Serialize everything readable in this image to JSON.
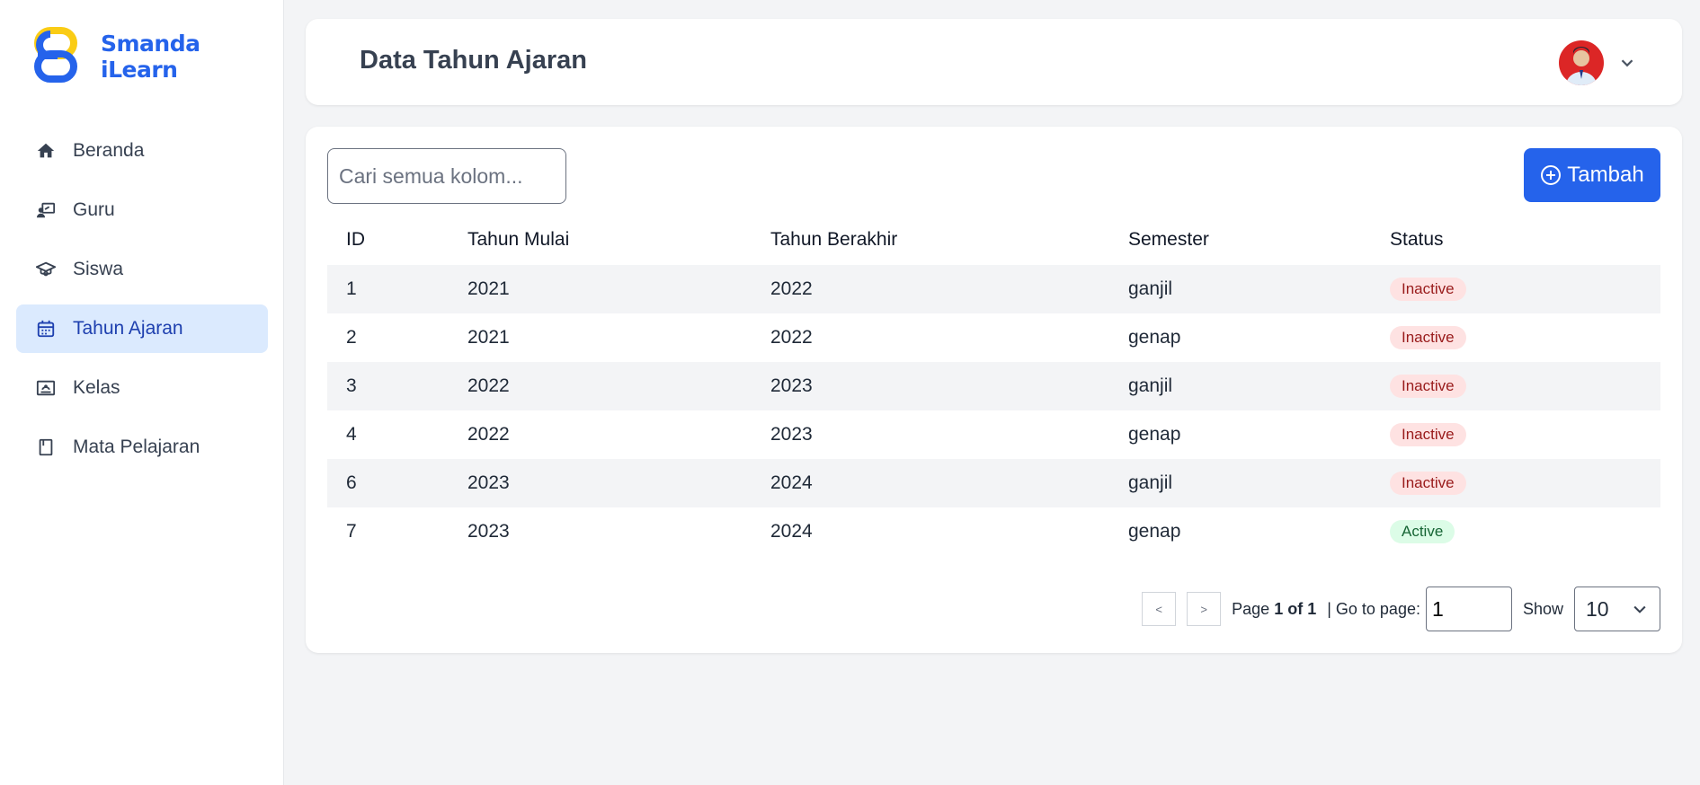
{
  "app": {
    "logo_line1": "Smanda",
    "logo_line2": "iLearn",
    "brand_colors": {
      "blue": "#2563eb",
      "yellow": "#facc15"
    }
  },
  "sidebar": {
    "items": [
      {
        "label": "Beranda",
        "icon": "home-icon",
        "active": false
      },
      {
        "label": "Guru",
        "icon": "teacher-icon",
        "active": false
      },
      {
        "label": "Siswa",
        "icon": "graduation-cap-icon",
        "active": false
      },
      {
        "label": "Tahun Ajaran",
        "icon": "calendar-icon",
        "active": true
      },
      {
        "label": "Kelas",
        "icon": "classroom-icon",
        "active": false
      },
      {
        "label": "Mata Pelajaran",
        "icon": "book-icon",
        "active": false
      }
    ]
  },
  "header": {
    "title": "Data Tahun Ajaran"
  },
  "toolbar": {
    "search_placeholder": "Cari semua kolom...",
    "search_value": "",
    "add_label": "Tambah"
  },
  "table": {
    "columns": [
      "ID",
      "Tahun Mulai",
      "Tahun Berakhir",
      "Semester",
      "Status"
    ],
    "rows": [
      {
        "id": "1",
        "start": "2021",
        "end": "2022",
        "semester": "ganjil",
        "status": "Inactive"
      },
      {
        "id": "2",
        "start": "2021",
        "end": "2022",
        "semester": "genap",
        "status": "Inactive"
      },
      {
        "id": "3",
        "start": "2022",
        "end": "2023",
        "semester": "ganjil",
        "status": "Inactive"
      },
      {
        "id": "4",
        "start": "2022",
        "end": "2023",
        "semester": "genap",
        "status": "Inactive"
      },
      {
        "id": "6",
        "start": "2023",
        "end": "2024",
        "semester": "ganjil",
        "status": "Inactive"
      },
      {
        "id": "7",
        "start": "2023",
        "end": "2024",
        "semester": "genap",
        "status": "Active"
      }
    ]
  },
  "pagination": {
    "prev_label": "<",
    "next_label": ">",
    "page_prefix": "Page",
    "page_info": "1 of 1",
    "goto_label": "| Go to page:",
    "goto_value": "1",
    "show_label": "Show",
    "page_size": "10"
  }
}
